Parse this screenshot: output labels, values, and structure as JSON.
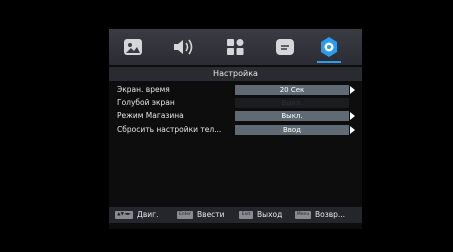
{
  "tabs": [
    {
      "icon": "picture-icon"
    },
    {
      "icon": "speaker-icon"
    },
    {
      "icon": "apps-icon"
    },
    {
      "icon": "channels-icon"
    },
    {
      "icon": "settings-gear-icon",
      "active": true
    }
  ],
  "header": {
    "title": "Настройка"
  },
  "rows": [
    {
      "label": "Экран. время",
      "value": "20 Сек",
      "arrow": true,
      "enabled": true
    },
    {
      "label": "Голубой экран",
      "value": "Выкл.",
      "arrow": false,
      "enabled": false
    },
    {
      "label": "Режим Магазина",
      "value": "Выкл.",
      "arrow": true,
      "enabled": true
    },
    {
      "label": "Сбросить настройки тел...",
      "value": "Ввод",
      "arrow": true,
      "enabled": true
    }
  ],
  "footer": {
    "nav_key": "▲▼◄►",
    "nav_label": "Двиг.",
    "enter_key": "Enter",
    "enter_label": "Ввести",
    "exit_key": "Exit",
    "exit_label": "Выход",
    "menu_key": "Menu",
    "menu_label": "Возвр..."
  },
  "colors": {
    "accent": "#2a9cf0",
    "value_bg": "#5f6a74",
    "disabled_bg": "#1a1c1e"
  }
}
